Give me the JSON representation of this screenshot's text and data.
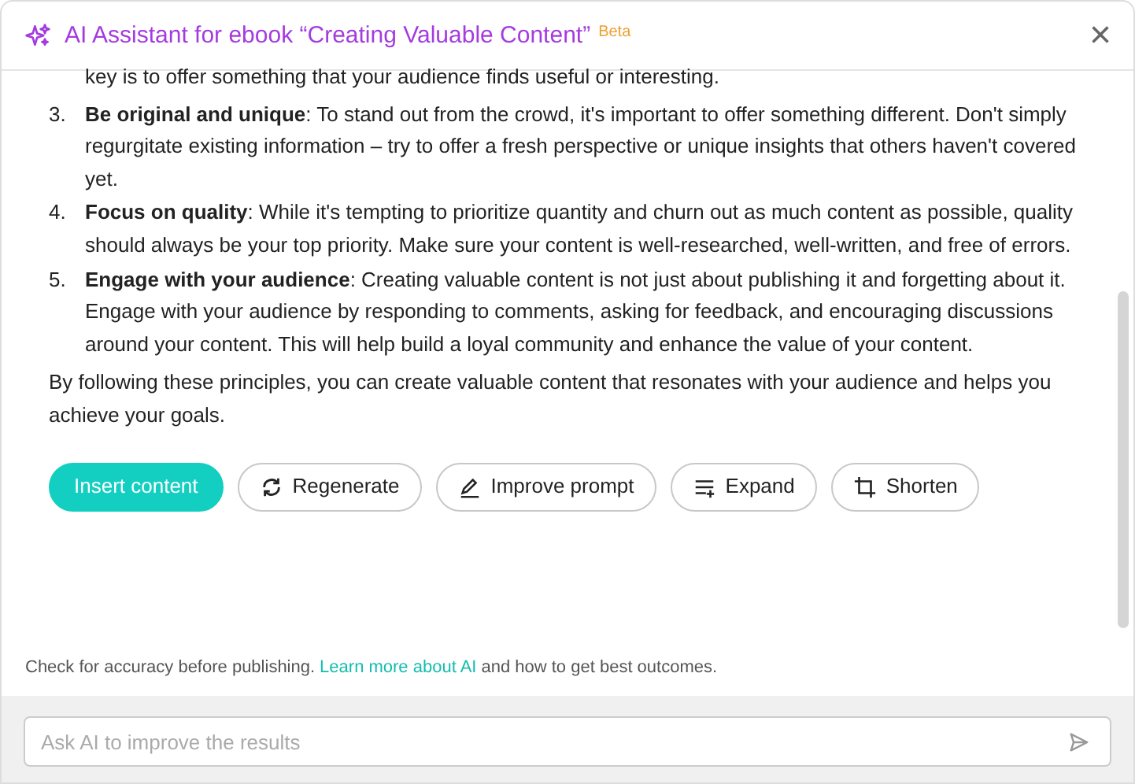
{
  "header": {
    "title": "AI Assistant for ebook “Creating Valuable Content”",
    "badge": "Beta",
    "close": "×"
  },
  "content": {
    "lead": "key is to offer something that your audience finds useful or interesting.",
    "items": [
      {
        "number": "3.",
        "text": "**Be original and unique**: To stand out from the crowd, it's important to offer something different. Don't simply regurgitate existing information – try to offer a fresh perspective or unique insights that others haven't covered yet."
      },
      {
        "number": "4.",
        "text": "**Focus on quality**: While it's tempting to prioritize quantity and churn out as much content as possible, quality should always be your top priority. Make sure your content is well-researched, well-written, and free of errors."
      },
      {
        "number": "5.",
        "text": "**Engage with your audience**: Creating valuable content is not just about publishing it and forgetting about it. Engage with your audience by responding to comments, asking for feedback, and encouraging discussions around your content. This will help build a loyal community and enhance the value of your content."
      }
    ],
    "conclusion": "By following these principles, you can create valuable content that resonates with your audience and helps you achieve your goals."
  },
  "actions": [
    {
      "label": "Insert content",
      "kind": "primary"
    },
    {
      "label": "Regenerate",
      "kind": "regenerate"
    },
    {
      "label": "Improve prompt",
      "kind": "improve"
    },
    {
      "label": "Expand",
      "kind": "expand"
    },
    {
      "label": "Shorten",
      "kind": "shorten"
    }
  ],
  "disclaimer": {
    "before": "Check for accuracy before publishing.",
    "link": "Learn more about AI",
    "after": "and how to get best outcomes."
  },
  "prompt": {
    "placeholder": "Ask AI to improve the results"
  }
}
